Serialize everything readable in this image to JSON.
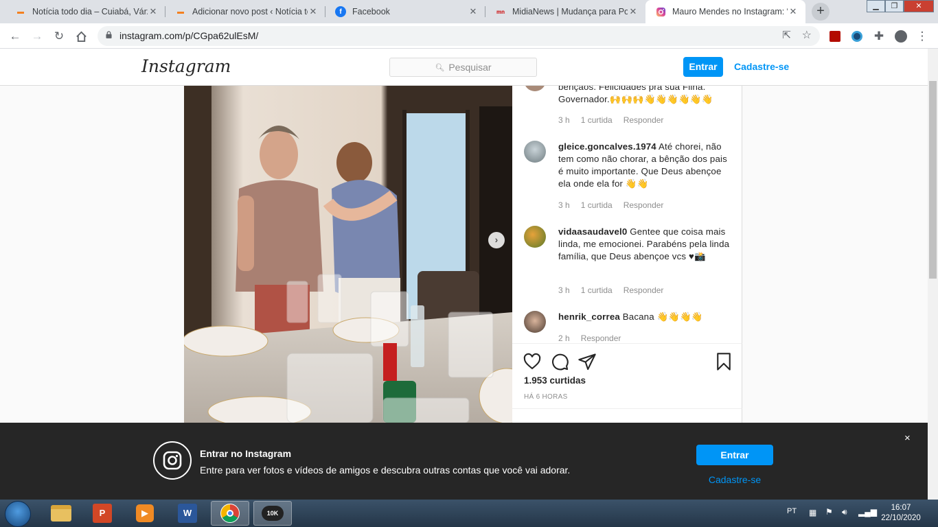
{
  "browser": {
    "tabs": [
      {
        "title": "Notícia todo dia – Cuiabá, Várzea",
        "icon": "blogger-icon",
        "active": false
      },
      {
        "title": "Adicionar novo post ‹ Notícia todo",
        "icon": "blogger-icon",
        "active": false
      },
      {
        "title": "Facebook",
        "icon": "facebook-icon",
        "active": false
      },
      {
        "title": "MidiaNews | Mudança para Portu",
        "icon": "midianews-icon",
        "active": false
      },
      {
        "title": "Mauro Mendes no Instagram: “F",
        "icon": "instagram-icon",
        "active": true
      }
    ],
    "new_tab": "+",
    "url": "instagram.com/p/CGpa62ulEsM/"
  },
  "instagram": {
    "logo": "Instagram",
    "search_placeholder": "Pesquisar",
    "login_label": "Entrar",
    "signup_label": "Cadastre-se"
  },
  "post": {
    "comments": [
      {
        "partial": true,
        "text": "bençãos. Felicidades pra sua Filha. Governador.🙌🙌🙌👋👋👋👋👋👋",
        "time": "3 h",
        "likes": "1 curtida",
        "reply": "Responder"
      },
      {
        "username": "gleice.goncalves.1974",
        "text": " Até chorei, não tem como não chorar, a bênção dos pais é muito importante. Que Deus abençoe ela onde ela for 👋👋",
        "time": "3 h",
        "likes": "1 curtida",
        "reply": "Responder"
      },
      {
        "username": "vidaasaudavel0",
        "text": " Gentee que coisa mais linda, me emocionei. Parabéns pela linda família, que Deus abençoe vcs ♥📸",
        "time": "3 h",
        "likes": "1 curtida",
        "reply": "Responder"
      },
      {
        "username": "henrik_correa",
        "text": " Bacana 👋👋👋👋",
        "time": "2 h",
        "likes": "",
        "reply": "Responder"
      }
    ],
    "likes_count": "1.953 curtidas",
    "time_ago": "HÁ 6 HORAS"
  },
  "login_banner": {
    "title": "Entrar no Instagram",
    "description": "Entre para ver fotos e vídeos de amigos e descubra outras contas que você vai adorar.",
    "login_label": "Entrar",
    "signup_label": "Cadastre-se",
    "close": "×"
  },
  "taskbar": {
    "apps": [
      "explorer-icon",
      "powerpoint-icon",
      "media-player-icon",
      "word-icon",
      "chrome-icon",
      "10k-icon"
    ],
    "app_10k_label": "10K",
    "language": "PT",
    "time": "16:07",
    "date": "22/10/2020"
  },
  "colors": {
    "accent": "#0095f6",
    "banner_bg": "#262626",
    "tab_bar": "#dee1e6"
  }
}
